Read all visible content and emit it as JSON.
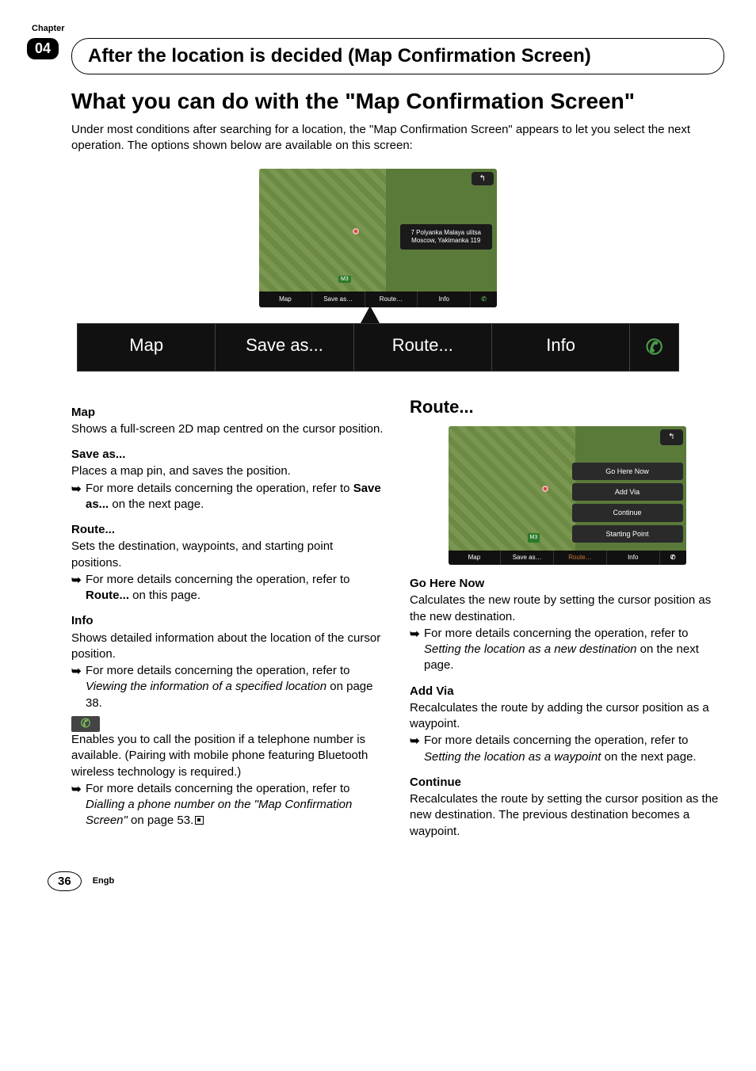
{
  "chapter": {
    "label": "Chapter",
    "number": "04"
  },
  "header": {
    "title": "After the location is decided (Map Confirmation Screen)"
  },
  "main_title": "What you can do with the \"Map Confirmation Screen\"",
  "intro": "Under most conditions after searching for a location, the \"Map Confirmation Screen\" appears to let you select the next operation. The options shown below are available on this screen:",
  "screenshot1": {
    "address_line1": "7 Polyanka Malaya ulitsa",
    "address_line2": "Moscow, Yakimanka 119",
    "m3": "M3",
    "back": "↰",
    "btns": {
      "map": "Map",
      "saveas": "Save as…",
      "route": "Route…",
      "info": "Info"
    }
  },
  "button_row": {
    "map": "Map",
    "saveas": "Save as...",
    "route": "Route...",
    "info": "Info"
  },
  "left": {
    "map": {
      "title": "Map",
      "text": "Shows a full-screen 2D map centred on the cursor position."
    },
    "saveas": {
      "title": "Save as...",
      "text": "Places a map pin, and saves the position.",
      "bullet_lead": "For more details concerning the operation, refer to ",
      "bullet_bold": "Save as...",
      "bullet_trail": " on the next page."
    },
    "route": {
      "title": "Route...",
      "text": "Sets the destination, waypoints, and starting point positions.",
      "bullet_lead": "For more details concerning the operation, refer to ",
      "bullet_bold": "Route...",
      "bullet_trail": " on this page."
    },
    "info": {
      "title": "Info",
      "text": "Shows detailed information about the location of the cursor position.",
      "bullet_lead": "For more details concerning the operation, refer to ",
      "bullet_italic": "Viewing the information of a specified location",
      "bullet_trail": " on page 38."
    },
    "phone": {
      "text": "Enables you to call the position if a telephone number is available. (Pairing with mobile phone featuring Bluetooth wireless technology is required.)",
      "bullet_lead": "For more details concerning the operation, refer to ",
      "bullet_italic": "Dialling a phone number on the \"Map Confirmation Screen\"",
      "bullet_trail": " on page 53."
    }
  },
  "right": {
    "title": "Route...",
    "screenshot": {
      "menu": {
        "go": "Go Here Now",
        "addvia": "Add Via",
        "continue": "Continue",
        "starting": "Starting Point"
      },
      "back": "↰",
      "m3": "M3",
      "btns": {
        "map": "Map",
        "saveas": "Save as…",
        "route": "Route…",
        "info": "Info"
      }
    },
    "go": {
      "title": "Go Here Now",
      "text": "Calculates the new route by setting the cursor position as the new destination.",
      "bullet_lead": "For more details concerning the operation, refer to ",
      "bullet_italic": "Setting the location as a new destination",
      "bullet_trail": " on the next page."
    },
    "addvia": {
      "title": "Add Via",
      "text": "Recalculates the route by adding the cursor position as a waypoint.",
      "bullet_lead": "For more details concerning the operation, refer to ",
      "bullet_italic": "Setting the location as a waypoint",
      "bullet_trail": " on the next page."
    },
    "continue": {
      "title": "Continue",
      "text": "Recalculates the route by setting the cursor position as the new destination. The previous destination becomes a waypoint."
    }
  },
  "footer": {
    "page": "36",
    "lang": "Engb"
  }
}
